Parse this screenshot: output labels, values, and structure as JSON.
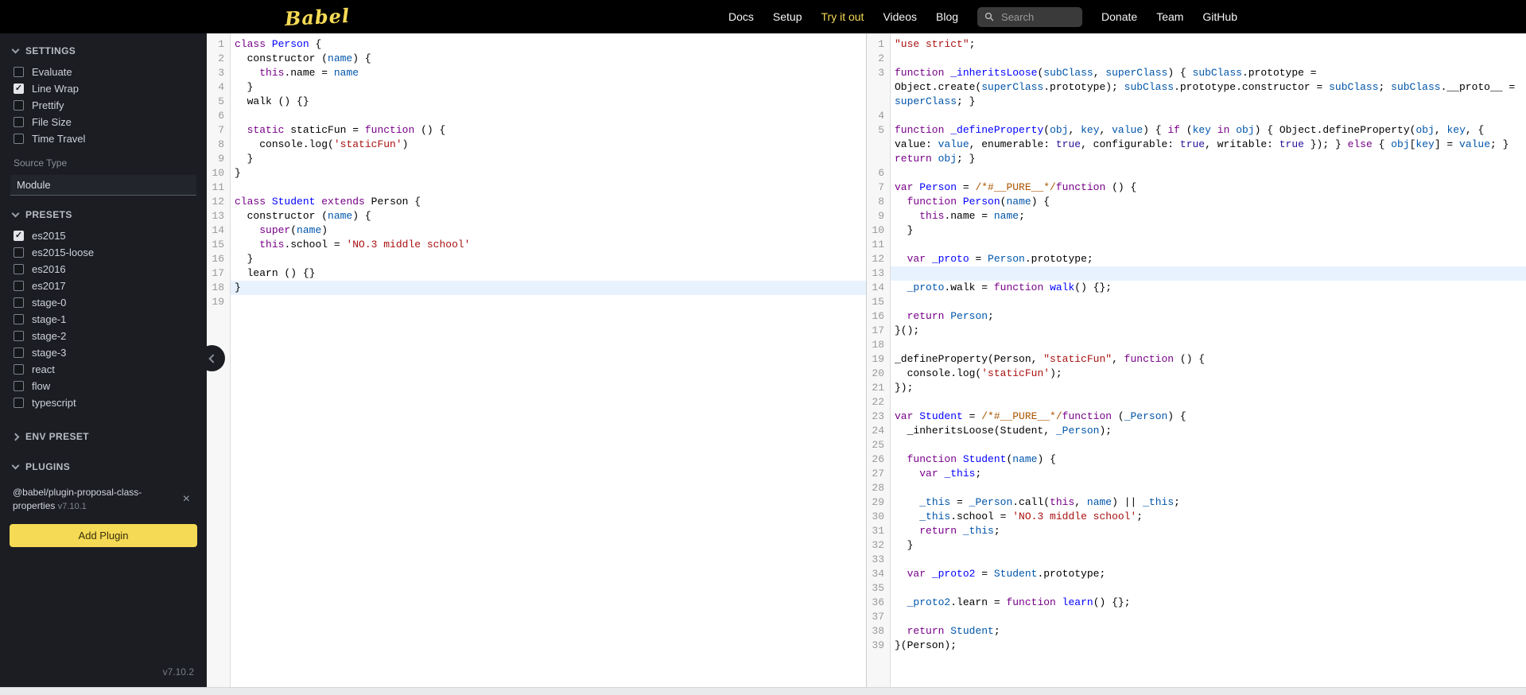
{
  "colors": {
    "brand_yellow": "#f5da55",
    "active_line_highlight": "#e8f2ff"
  },
  "nav": {
    "logo": "Babel",
    "links": [
      {
        "label": "Docs",
        "active": false
      },
      {
        "label": "Setup",
        "active": false
      },
      {
        "label": "Try it out",
        "active": true
      },
      {
        "label": "Videos",
        "active": false
      },
      {
        "label": "Blog",
        "active": false
      }
    ],
    "search_placeholder": "Search",
    "right_links": [
      {
        "label": "Donate"
      },
      {
        "label": "Team"
      },
      {
        "label": "GitHub"
      }
    ]
  },
  "sidebar": {
    "settings": {
      "title": "SETTINGS",
      "items": [
        {
          "label": "Evaluate",
          "checked": false
        },
        {
          "label": "Line Wrap",
          "checked": true
        },
        {
          "label": "Prettify",
          "checked": false
        },
        {
          "label": "File Size",
          "checked": false
        },
        {
          "label": "Time Travel",
          "checked": false
        }
      ]
    },
    "source_type": {
      "label": "Source Type",
      "value": "Module"
    },
    "presets": {
      "title": "PRESETS",
      "items": [
        {
          "label": "es2015",
          "checked": true
        },
        {
          "label": "es2015-loose",
          "checked": false
        },
        {
          "label": "es2016",
          "checked": false
        },
        {
          "label": "es2017",
          "checked": false
        },
        {
          "label": "stage-0",
          "checked": false
        },
        {
          "label": "stage-1",
          "checked": false
        },
        {
          "label": "stage-2",
          "checked": false
        },
        {
          "label": "stage-3",
          "checked": false
        },
        {
          "label": "react",
          "checked": false
        },
        {
          "label": "flow",
          "checked": false
        },
        {
          "label": "typescript",
          "checked": false
        }
      ]
    },
    "env_preset": {
      "title": "ENV PRESET"
    },
    "plugins": {
      "title": "PLUGINS",
      "installed": [
        {
          "name": "@babel/plugin-proposal-class-properties",
          "version": "v7.10.1"
        }
      ],
      "add_button": "Add Plugin"
    },
    "version": "v7.10.2"
  },
  "editors": {
    "input": {
      "active_line": 18,
      "lines": [
        [
          [
            "k",
            "class"
          ],
          [
            "p",
            " "
          ],
          [
            "d",
            "Person"
          ],
          [
            "p",
            " {"
          ]
        ],
        [
          [
            "p",
            "  constructor ("
          ],
          [
            "v",
            "name"
          ],
          [
            "p",
            ") {"
          ]
        ],
        [
          [
            "p",
            "    "
          ],
          [
            "k",
            "this"
          ],
          [
            "p",
            ".name = "
          ],
          [
            "v",
            "name"
          ]
        ],
        [
          [
            "p",
            "  }"
          ]
        ],
        [
          [
            "p",
            "  walk () {}"
          ]
        ],
        [],
        [
          [
            "p",
            "  "
          ],
          [
            "k",
            "static"
          ],
          [
            "p",
            " staticFun = "
          ],
          [
            "k",
            "function"
          ],
          [
            "p",
            " () {"
          ]
        ],
        [
          [
            "p",
            "    console.log("
          ],
          [
            "s",
            "'staticFun'"
          ],
          [
            "p",
            ")"
          ]
        ],
        [
          [
            "p",
            "  }"
          ]
        ],
        [
          [
            "p",
            "}"
          ]
        ],
        [],
        [
          [
            "k",
            "class"
          ],
          [
            "p",
            " "
          ],
          [
            "d",
            "Student"
          ],
          [
            "p",
            " "
          ],
          [
            "k",
            "extends"
          ],
          [
            "p",
            " Person {"
          ]
        ],
        [
          [
            "p",
            "  constructor ("
          ],
          [
            "v",
            "name"
          ],
          [
            "p",
            ") {"
          ]
        ],
        [
          [
            "p",
            "    "
          ],
          [
            "k",
            "super"
          ],
          [
            "p",
            "("
          ],
          [
            "v",
            "name"
          ],
          [
            "p",
            ")"
          ]
        ],
        [
          [
            "p",
            "    "
          ],
          [
            "k",
            "this"
          ],
          [
            "p",
            ".school = "
          ],
          [
            "s",
            "'NO.3 middle school'"
          ]
        ],
        [
          [
            "p",
            "  }"
          ]
        ],
        [
          [
            "p",
            "  learn () {}"
          ]
        ],
        [
          [
            "p",
            "}"
          ]
        ],
        []
      ]
    },
    "output": {
      "active_line": 13,
      "lines": [
        [
          [
            "s",
            "\"use strict\""
          ],
          [
            "p",
            ";"
          ]
        ],
        [],
        [
          [
            "k",
            "function"
          ],
          [
            "p",
            " "
          ],
          [
            "d",
            "_inheritsLoose"
          ],
          [
            "p",
            "("
          ],
          [
            "v",
            "subClass"
          ],
          [
            "p",
            ", "
          ],
          [
            "v",
            "superClass"
          ],
          [
            "p",
            ") { "
          ],
          [
            "v",
            "subClass"
          ],
          [
            "p",
            ".prototype = Object.create("
          ],
          [
            "v",
            "superClass"
          ],
          [
            "p",
            ".prototype); "
          ],
          [
            "v",
            "subClass"
          ],
          [
            "p",
            ".prototype.constructor = "
          ],
          [
            "v",
            "subClass"
          ],
          [
            "p",
            "; "
          ],
          [
            "v",
            "subClass"
          ],
          [
            "p",
            ".__proto__ = "
          ],
          [
            "v",
            "superClass"
          ],
          [
            "p",
            "; }"
          ]
        ],
        [],
        [
          [
            "k",
            "function"
          ],
          [
            "p",
            " "
          ],
          [
            "d",
            "_defineProperty"
          ],
          [
            "p",
            "("
          ],
          [
            "v",
            "obj"
          ],
          [
            "p",
            ", "
          ],
          [
            "v",
            "key"
          ],
          [
            "p",
            ", "
          ],
          [
            "v",
            "value"
          ],
          [
            "p",
            ") { "
          ],
          [
            "k",
            "if"
          ],
          [
            "p",
            " ("
          ],
          [
            "v",
            "key"
          ],
          [
            "p",
            " "
          ],
          [
            "k",
            "in"
          ],
          [
            "p",
            " "
          ],
          [
            "v",
            "obj"
          ],
          [
            "p",
            ") { Object.defineProperty("
          ],
          [
            "v",
            "obj"
          ],
          [
            "p",
            ", "
          ],
          [
            "v",
            "key"
          ],
          [
            "p",
            ", { value: "
          ],
          [
            "v",
            "value"
          ],
          [
            "p",
            ", enumerable: "
          ],
          [
            "a",
            "true"
          ],
          [
            "p",
            ", configurable: "
          ],
          [
            "a",
            "true"
          ],
          [
            "p",
            ", writable: "
          ],
          [
            "a",
            "true"
          ],
          [
            "p",
            " }); } "
          ],
          [
            "k",
            "else"
          ],
          [
            "p",
            " { "
          ],
          [
            "v",
            "obj"
          ],
          [
            "p",
            "["
          ],
          [
            "v",
            "key"
          ],
          [
            "p",
            "] = "
          ],
          [
            "v",
            "value"
          ],
          [
            "p",
            "; } "
          ],
          [
            "k",
            "return"
          ],
          [
            "p",
            " "
          ],
          [
            "v",
            "obj"
          ],
          [
            "p",
            "; }"
          ]
        ],
        [],
        [
          [
            "k",
            "var"
          ],
          [
            "p",
            " "
          ],
          [
            "d",
            "Person"
          ],
          [
            "p",
            " = "
          ],
          [
            "c",
            "/*#__PURE__*/"
          ],
          [
            "k",
            "function"
          ],
          [
            "p",
            " () {"
          ]
        ],
        [
          [
            "p",
            "  "
          ],
          [
            "k",
            "function"
          ],
          [
            "p",
            " "
          ],
          [
            "d",
            "Person"
          ],
          [
            "p",
            "("
          ],
          [
            "v",
            "name"
          ],
          [
            "p",
            ") {"
          ]
        ],
        [
          [
            "p",
            "    "
          ],
          [
            "k",
            "this"
          ],
          [
            "p",
            ".name = "
          ],
          [
            "v",
            "name"
          ],
          [
            "p",
            ";"
          ]
        ],
        [
          [
            "p",
            "  }"
          ]
        ],
        [],
        [
          [
            "p",
            "  "
          ],
          [
            "k",
            "var"
          ],
          [
            "p",
            " "
          ],
          [
            "d",
            "_proto"
          ],
          [
            "p",
            " = "
          ],
          [
            "v",
            "Person"
          ],
          [
            "p",
            ".prototype;"
          ]
        ],
        [],
        [
          [
            "p",
            "  "
          ],
          [
            "v",
            "_proto"
          ],
          [
            "p",
            ".walk = "
          ],
          [
            "k",
            "function"
          ],
          [
            "p",
            " "
          ],
          [
            "d",
            "walk"
          ],
          [
            "p",
            "() {};"
          ]
        ],
        [],
        [
          [
            "p",
            "  "
          ],
          [
            "k",
            "return"
          ],
          [
            "p",
            " "
          ],
          [
            "v",
            "Person"
          ],
          [
            "p",
            ";"
          ]
        ],
        [
          [
            "p",
            "}();"
          ]
        ],
        [],
        [
          [
            "p",
            "_defineProperty(Person, "
          ],
          [
            "s",
            "\"staticFun\""
          ],
          [
            "p",
            ", "
          ],
          [
            "k",
            "function"
          ],
          [
            "p",
            " () {"
          ]
        ],
        [
          [
            "p",
            "  console.log("
          ],
          [
            "s",
            "'staticFun'"
          ],
          [
            "p",
            ");"
          ]
        ],
        [
          [
            "p",
            "});"
          ]
        ],
        [],
        [
          [
            "k",
            "var"
          ],
          [
            "p",
            " "
          ],
          [
            "d",
            "Student"
          ],
          [
            "p",
            " = "
          ],
          [
            "c",
            "/*#__PURE__*/"
          ],
          [
            "k",
            "function"
          ],
          [
            "p",
            " ("
          ],
          [
            "v",
            "_Person"
          ],
          [
            "p",
            ") {"
          ]
        ],
        [
          [
            "p",
            "  _inheritsLoose(Student, "
          ],
          [
            "v",
            "_Person"
          ],
          [
            "p",
            ");"
          ]
        ],
        [],
        [
          [
            "p",
            "  "
          ],
          [
            "k",
            "function"
          ],
          [
            "p",
            " "
          ],
          [
            "d",
            "Student"
          ],
          [
            "p",
            "("
          ],
          [
            "v",
            "name"
          ],
          [
            "p",
            ") {"
          ]
        ],
        [
          [
            "p",
            "    "
          ],
          [
            "k",
            "var"
          ],
          [
            "p",
            " "
          ],
          [
            "d",
            "_this"
          ],
          [
            "p",
            ";"
          ]
        ],
        [],
        [
          [
            "p",
            "    "
          ],
          [
            "v",
            "_this"
          ],
          [
            "p",
            " = "
          ],
          [
            "v",
            "_Person"
          ],
          [
            "p",
            ".call("
          ],
          [
            "k",
            "this"
          ],
          [
            "p",
            ", "
          ],
          [
            "v",
            "name"
          ],
          [
            "p",
            ") || "
          ],
          [
            "v",
            "_this"
          ],
          [
            "p",
            ";"
          ]
        ],
        [
          [
            "p",
            "    "
          ],
          [
            "v",
            "_this"
          ],
          [
            "p",
            ".school = "
          ],
          [
            "s",
            "'NO.3 middle school'"
          ],
          [
            "p",
            ";"
          ]
        ],
        [
          [
            "p",
            "    "
          ],
          [
            "k",
            "return"
          ],
          [
            "p",
            " "
          ],
          [
            "v",
            "_this"
          ],
          [
            "p",
            ";"
          ]
        ],
        [
          [
            "p",
            "  }"
          ]
        ],
        [],
        [
          [
            "p",
            "  "
          ],
          [
            "k",
            "var"
          ],
          [
            "p",
            " "
          ],
          [
            "d",
            "_proto2"
          ],
          [
            "p",
            " = "
          ],
          [
            "v",
            "Student"
          ],
          [
            "p",
            ".prototype;"
          ]
        ],
        [],
        [
          [
            "p",
            "  "
          ],
          [
            "v",
            "_proto2"
          ],
          [
            "p",
            ".learn = "
          ],
          [
            "k",
            "function"
          ],
          [
            "p",
            " "
          ],
          [
            "d",
            "learn"
          ],
          [
            "p",
            "() {};"
          ]
        ],
        [],
        [
          [
            "p",
            "  "
          ],
          [
            "k",
            "return"
          ],
          [
            "p",
            " "
          ],
          [
            "v",
            "Student"
          ],
          [
            "p",
            ";"
          ]
        ],
        [
          [
            "p",
            "}(Person);"
          ]
        ]
      ]
    }
  }
}
